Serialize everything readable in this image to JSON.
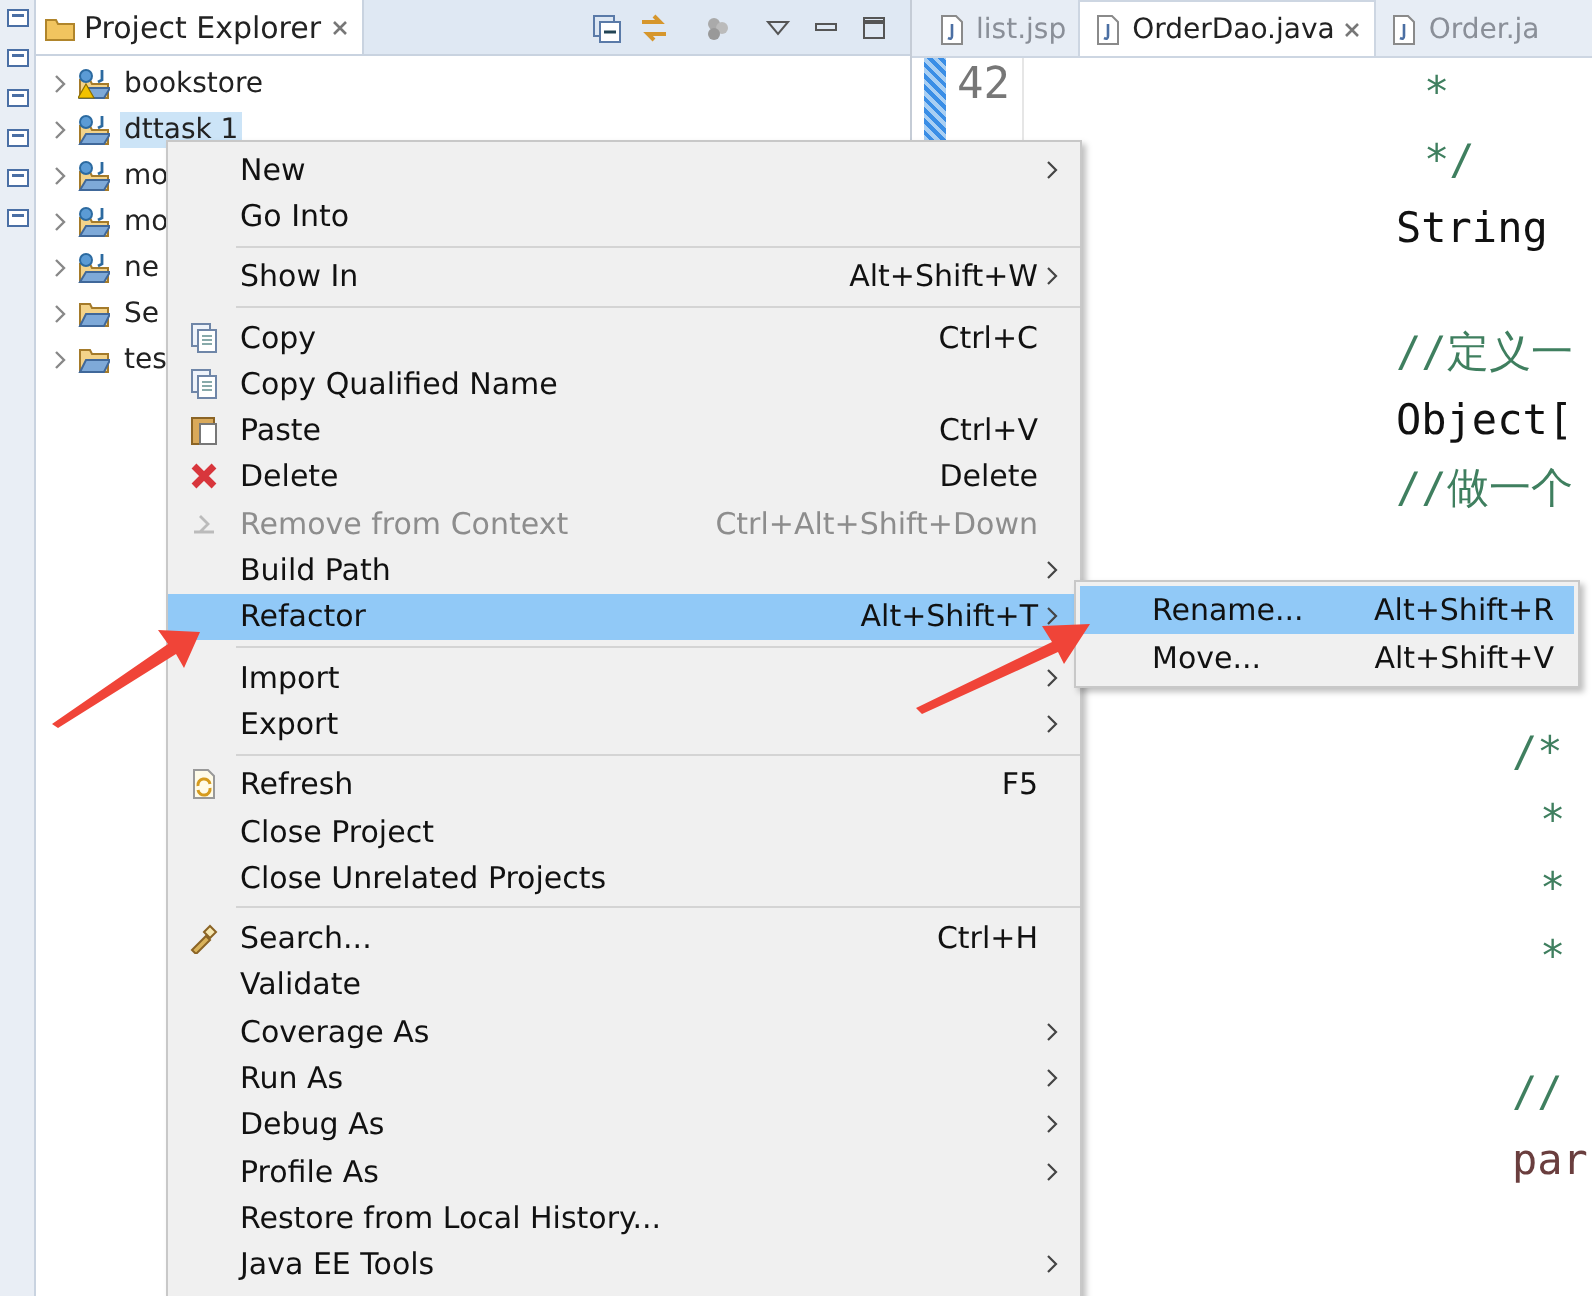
{
  "explorer": {
    "title": "Project Explorer",
    "items": [
      {
        "label": "bookstore",
        "kind": "project",
        "warning": true,
        "selected": false
      },
      {
        "label": "dttask 1",
        "kind": "project",
        "warning": false,
        "selected": true
      },
      {
        "label": "mo",
        "kind": "project",
        "warning": false,
        "selected": false
      },
      {
        "label": "mo",
        "kind": "project",
        "warning": false,
        "selected": false
      },
      {
        "label": "ne",
        "kind": "project",
        "warning": false,
        "selected": false
      },
      {
        "label": "Se",
        "kind": "folder",
        "warning": false,
        "selected": false
      },
      {
        "label": "tes",
        "kind": "folder",
        "warning": false,
        "selected": false
      }
    ]
  },
  "editor": {
    "tabs": [
      {
        "label": "list.jsp",
        "selected": false,
        "closable": false
      },
      {
        "label": "OrderDao.java",
        "selected": true,
        "closable": true
      },
      {
        "label": "Order.ja",
        "selected": false,
        "closable": false
      }
    ],
    "line_numbers": [
      "42"
    ],
    "blocks": [
      {
        "indented": false,
        "lines": [
          {
            "text": "*",
            "kind": "comment"
          },
          {
            "text": "*/",
            "kind": "comment"
          },
          {
            "text": "String",
            "kind": "code"
          }
        ]
      },
      {
        "indented": false,
        "lines": [
          {
            "text": "//定义一",
            "kind": "comment"
          },
          {
            "text": "Object[",
            "kind": "code"
          },
          {
            "text": "//做一个",
            "kind": "comment"
          }
        ]
      },
      {
        "indented": true,
        "lines": [
          {
            "text": "/*",
            "kind": "comment"
          },
          {
            "text": "*",
            "kind": "comment"
          },
          {
            "text": "*",
            "kind": "comment"
          },
          {
            "text": "*",
            "kind": "comment"
          }
        ]
      },
      {
        "indented": true,
        "lines": [
          {
            "text": "//",
            "kind": "comment"
          },
          {
            "text": "par",
            "kind": "variable"
          }
        ]
      }
    ]
  },
  "context_menu": [
    {
      "kind": "item",
      "label": "New",
      "submenu": true,
      "selected": false,
      "disabled": false
    },
    {
      "kind": "item",
      "label": "Go Into",
      "submenu": false,
      "selected": false,
      "disabled": false
    },
    {
      "kind": "separator"
    },
    {
      "kind": "item",
      "label": "Show In",
      "shortcut": "Alt+Shift+W",
      "submenu": true,
      "selected": false,
      "disabled": false
    },
    {
      "kind": "separator"
    },
    {
      "kind": "item",
      "label": "Copy",
      "shortcut": "Ctrl+C",
      "submenu": false,
      "selected": false,
      "disabled": false
    },
    {
      "kind": "item",
      "label": "Copy Qualified Name",
      "submenu": false,
      "selected": false,
      "disabled": false
    },
    {
      "kind": "item",
      "label": "Paste",
      "shortcut": "Ctrl+V",
      "submenu": false,
      "selected": false,
      "disabled": false
    },
    {
      "kind": "item",
      "label": "Delete",
      "shortcut": "Delete",
      "submenu": false,
      "selected": false,
      "disabled": false
    },
    {
      "kind": "item",
      "label": "Remove from Context",
      "shortcut": "Ctrl+Alt+Shift+Down",
      "submenu": false,
      "selected": false,
      "disabled": true
    },
    {
      "kind": "item",
      "label": "Build Path",
      "submenu": true,
      "selected": false,
      "disabled": false
    },
    {
      "kind": "item",
      "label": "Refactor",
      "shortcut": "Alt+Shift+T",
      "submenu": true,
      "selected": true,
      "disabled": false
    },
    {
      "kind": "separator"
    },
    {
      "kind": "item",
      "label": "Import",
      "submenu": true,
      "selected": false,
      "disabled": false
    },
    {
      "kind": "item",
      "label": "Export",
      "submenu": true,
      "selected": false,
      "disabled": false
    },
    {
      "kind": "separator"
    },
    {
      "kind": "item",
      "label": "Refresh",
      "shortcut": "F5",
      "submenu": false,
      "selected": false,
      "disabled": false
    },
    {
      "kind": "item",
      "label": "Close Project",
      "submenu": false,
      "selected": false,
      "disabled": false
    },
    {
      "kind": "item",
      "label": "Close Unrelated Projects",
      "submenu": false,
      "selected": false,
      "disabled": false
    },
    {
      "kind": "separator"
    },
    {
      "kind": "item",
      "label": "Search...",
      "shortcut": "Ctrl+H",
      "submenu": false,
      "selected": false,
      "disabled": false
    },
    {
      "kind": "item",
      "label": "Validate",
      "submenu": false,
      "selected": false,
      "disabled": false
    },
    {
      "kind": "item",
      "label": "Coverage As",
      "submenu": true,
      "selected": false,
      "disabled": false
    },
    {
      "kind": "item",
      "label": "Run As",
      "submenu": true,
      "selected": false,
      "disabled": false
    },
    {
      "kind": "item",
      "label": "Debug As",
      "submenu": true,
      "selected": false,
      "disabled": false
    },
    {
      "kind": "item",
      "label": "Profile As",
      "submenu": true,
      "selected": false,
      "disabled": false
    },
    {
      "kind": "item",
      "label": "Restore from Local History...",
      "submenu": false,
      "selected": false,
      "disabled": false
    },
    {
      "kind": "item",
      "label": "Java EE Tools",
      "submenu": true,
      "selected": false,
      "disabled": false
    }
  ],
  "refactor_submenu": [
    {
      "label": "Rename...",
      "shortcut": "Alt+Shift+R",
      "selected": true
    },
    {
      "label": "Move...",
      "shortcut": "Alt+Shift+V",
      "selected": false
    }
  ]
}
